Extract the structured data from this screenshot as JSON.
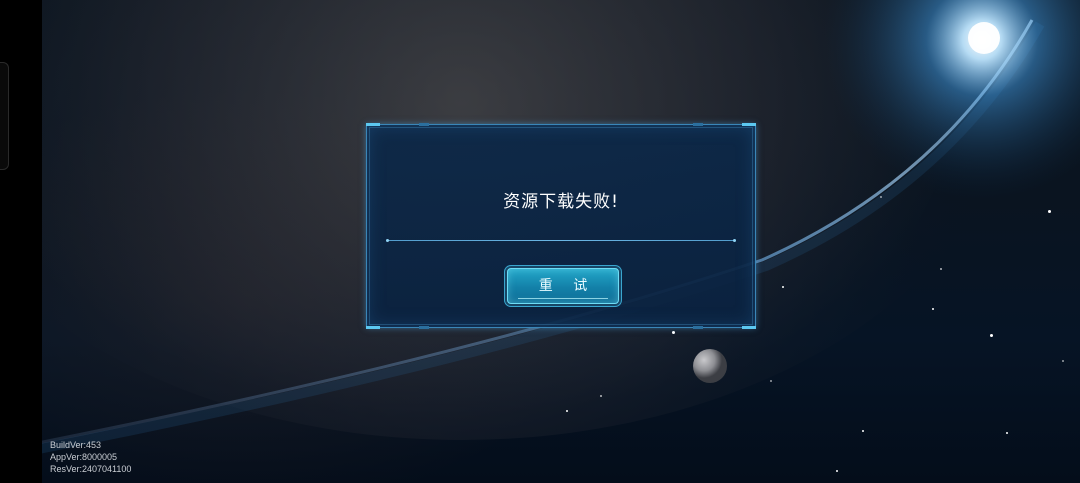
{
  "dialog": {
    "message": "资源下载失败!",
    "retry_label": "重 试"
  },
  "version_info": {
    "build": "BuildVer:453",
    "app": "AppVer:8000005",
    "res": "ResVer:2407041100"
  },
  "colors": {
    "dialog_border": "#3a86b8",
    "button_fill": "#1a93ba",
    "accent_glow": "#5cc8f0"
  }
}
